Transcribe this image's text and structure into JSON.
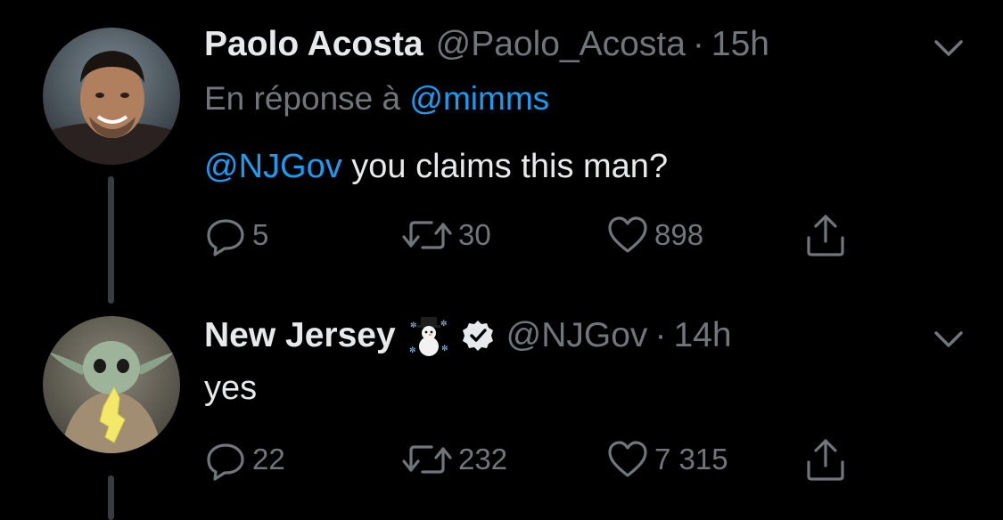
{
  "tweets": [
    {
      "author_name": "Paolo Acosta",
      "handle": "@Paolo_Acosta",
      "separator": "·",
      "time": "15h",
      "reply_prefix": "En réponse à",
      "reply_to": "@mimms",
      "mention": "@NJGov",
      "text": " you claims this man?",
      "replies": "5",
      "retweets": "30",
      "likes": "898",
      "avatar_icon": "person-avatar"
    },
    {
      "author_name": "New Jersey",
      "emoji_icon": "snowman-icon",
      "verified_icon": "verified-badge-icon",
      "handle": "@NJGov",
      "separator": "·",
      "time": "14h",
      "text": "yes",
      "replies": "22",
      "retweets": "232",
      "likes": "7 315",
      "avatar_icon": "baby-yoda-new-jersey-avatar"
    }
  ],
  "colors": {
    "background": "#000000",
    "muted": "#71767b",
    "link": "#1d9bf0",
    "text": "#e7e9ea",
    "thread_line": "#3a3d40"
  }
}
